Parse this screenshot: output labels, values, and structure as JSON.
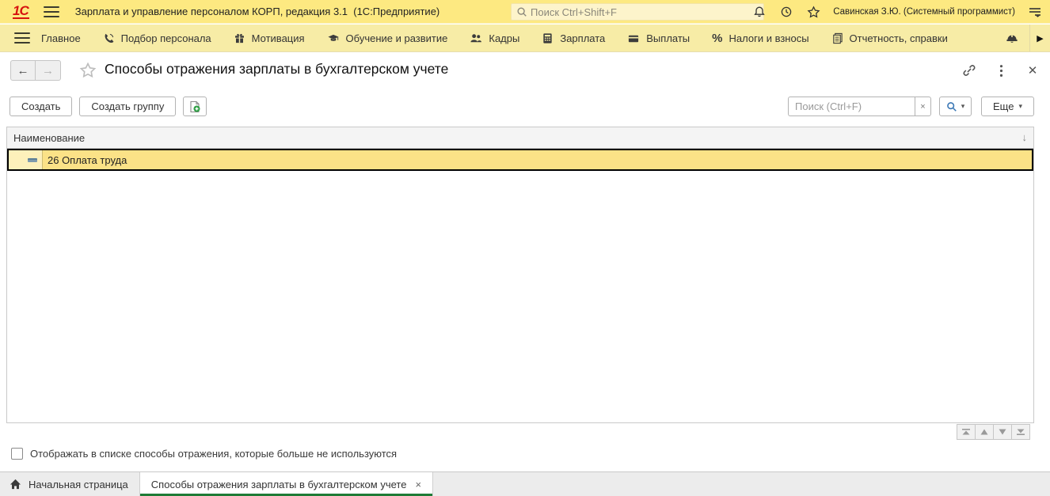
{
  "colors": {
    "topbar_bg": "#fde981",
    "menubar_bg": "#f7eca6",
    "selection_yellow": "#fbe287",
    "selection_border": "#000000",
    "active_tab_underline": "#1f7b36",
    "logo_red": "#d6120f",
    "magnifier_blue": "#3a77b5"
  },
  "topbar": {
    "logo_text": "1С",
    "app_title": "Зарплата и управление персоналом КОРП, редакция 3.1  (1С:Предприятие)",
    "search_placeholder": "Поиск Ctrl+Shift+F",
    "user_name": "Савинская З.Ю. (Системный программист)",
    "icons": [
      "menu-icon",
      "search-icon",
      "notifications-bell-icon",
      "history-clock-icon",
      "favorites-star-icon",
      "service-menu-icon"
    ]
  },
  "menubar": {
    "menu_icon": "sections-menu-icon",
    "items": [
      {
        "label": "Главное",
        "icon": "none"
      },
      {
        "label": "Подбор персонала",
        "icon": "phone-icon"
      },
      {
        "label": "Мотивация",
        "icon": "gift-icon"
      },
      {
        "label": "Обучение и развитие",
        "icon": "graduation-cap-icon"
      },
      {
        "label": "Кадры",
        "icon": "people-icon"
      },
      {
        "label": "Зарплата",
        "icon": "calculator-icon"
      },
      {
        "label": "Выплаты",
        "icon": "wallet-icon"
      },
      {
        "label": "Налоги и взносы",
        "icon": "percent-icon",
        "icon_glyph": "%"
      },
      {
        "label": "Отчетность, справки",
        "icon": "documents-icon"
      }
    ],
    "extra_icon": "hardhat-icon",
    "overflow_arrow": "▶"
  },
  "window": {
    "back_glyph": "←",
    "forward_glyph": "→",
    "title": "Способы отражения зарплаты в бухгалтерском учете",
    "header_icons": [
      "link-icon",
      "kebab-menu-icon",
      "close-icon"
    ],
    "close_glyph": "✕"
  },
  "toolbar": {
    "create_label": "Создать",
    "create_group_label": "Создать группу",
    "add_doc_icon": "new-document-plus-icon",
    "search_placeholder": "Поиск (Ctrl+F)",
    "clear_glyph": "×",
    "more_label": "Еще",
    "caret_glyph": "▾"
  },
  "table": {
    "columns": [
      {
        "label": "Наименование",
        "sort_glyph": "↓"
      }
    ],
    "rows": [
      {
        "name": "26 Оплата труда",
        "icon": "catalog-item-dash-icon",
        "selected": true
      }
    ]
  },
  "listnav": {
    "buttons": [
      "go-first-icon",
      "go-previous-icon",
      "go-next-icon",
      "go-last-icon"
    ]
  },
  "footer": {
    "checkbox_label": "Отображать в списке способы отражения, которые больше не используются",
    "checkbox_checked": false
  },
  "tabbar": {
    "tabs": [
      {
        "label": "Начальная страница",
        "icon": "home-icon",
        "active": false
      },
      {
        "label": "Способы отражения зарплаты в бухгалтерском учете",
        "active": true,
        "close_glyph": "×"
      }
    ]
  }
}
